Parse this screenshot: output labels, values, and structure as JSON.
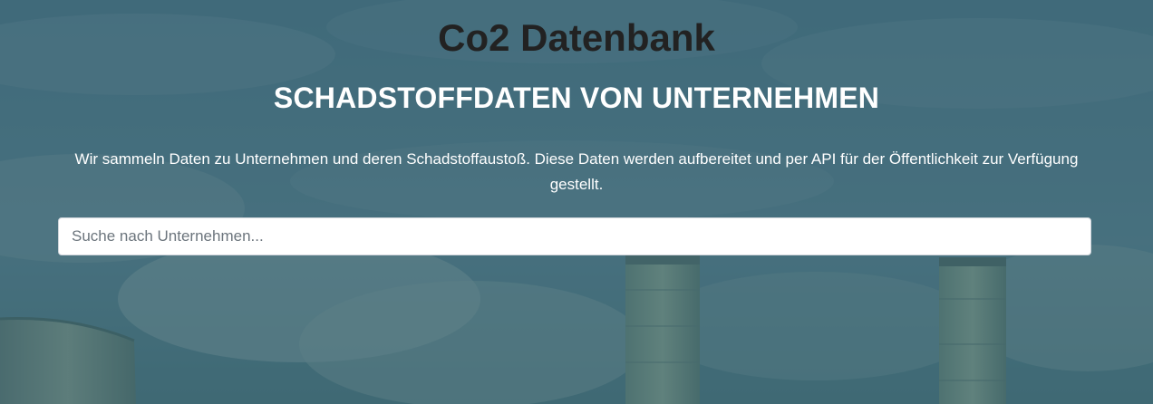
{
  "header": {
    "site_title": "Co2 Datenbank",
    "subtitle": "SCHADSTOFFDATEN VON UNTERNEHMEN"
  },
  "intro": {
    "description": "Wir sammeln Daten zu Unternehmen und deren Schadstoffaustoß. Diese Daten werden aufbereitet und per API für der Öffentlichkeit zur Verfügung gestellt."
  },
  "search": {
    "value": "",
    "placeholder": "Suche nach Unternehmen..."
  },
  "colors": {
    "overlay": "#264e60",
    "title": "#222222",
    "text": "#ffffff"
  }
}
